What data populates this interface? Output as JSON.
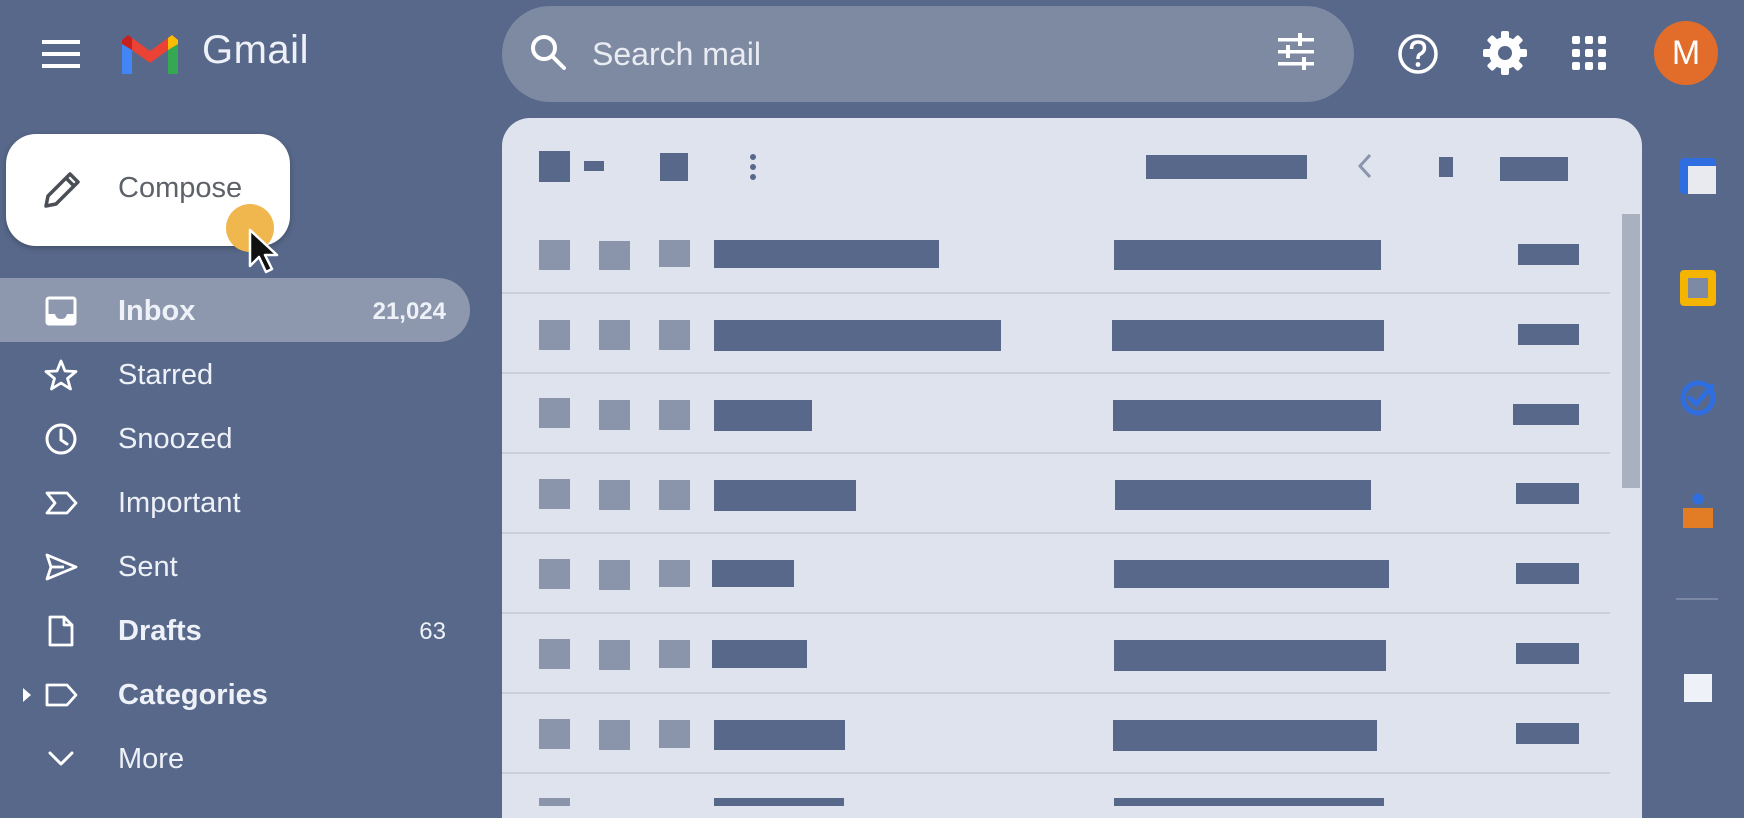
{
  "header": {
    "app_name": "Gmail",
    "search_placeholder": "Search mail",
    "avatar_letter": "M",
    "icons": [
      "menu-icon",
      "gmail-logo",
      "search-icon",
      "tune-icon",
      "help-icon",
      "gear-icon",
      "apps-icon"
    ]
  },
  "compose": {
    "label": "Compose"
  },
  "nav": {
    "items": [
      {
        "label": "Inbox",
        "count": "21,024",
        "icon": "inbox-icon",
        "bold": true,
        "active": true
      },
      {
        "label": "Starred",
        "count": "",
        "icon": "star-icon",
        "bold": false
      },
      {
        "label": "Snoozed",
        "count": "",
        "icon": "clock-icon",
        "bold": false
      },
      {
        "label": "Important",
        "count": "",
        "icon": "important-icon",
        "bold": false
      },
      {
        "label": "Sent",
        "count": "",
        "icon": "send-icon",
        "bold": false
      },
      {
        "label": "Drafts",
        "count": "63",
        "icon": "draft-icon",
        "bold": true
      },
      {
        "label": "Categories",
        "count": "",
        "icon": "label-icon",
        "bold": true
      },
      {
        "label": "More",
        "count": "",
        "icon": "chevron-down-icon",
        "bold": false
      }
    ]
  },
  "colors": {
    "background": "#57688a",
    "panel": "#dfe3ed",
    "avatar": "#e26d2b",
    "placeholder_bar": "#57688a"
  },
  "right_rail": {
    "icons": [
      "calendar-icon",
      "keep-icon",
      "tasks-icon",
      "contacts-icon",
      "add-icon"
    ]
  }
}
